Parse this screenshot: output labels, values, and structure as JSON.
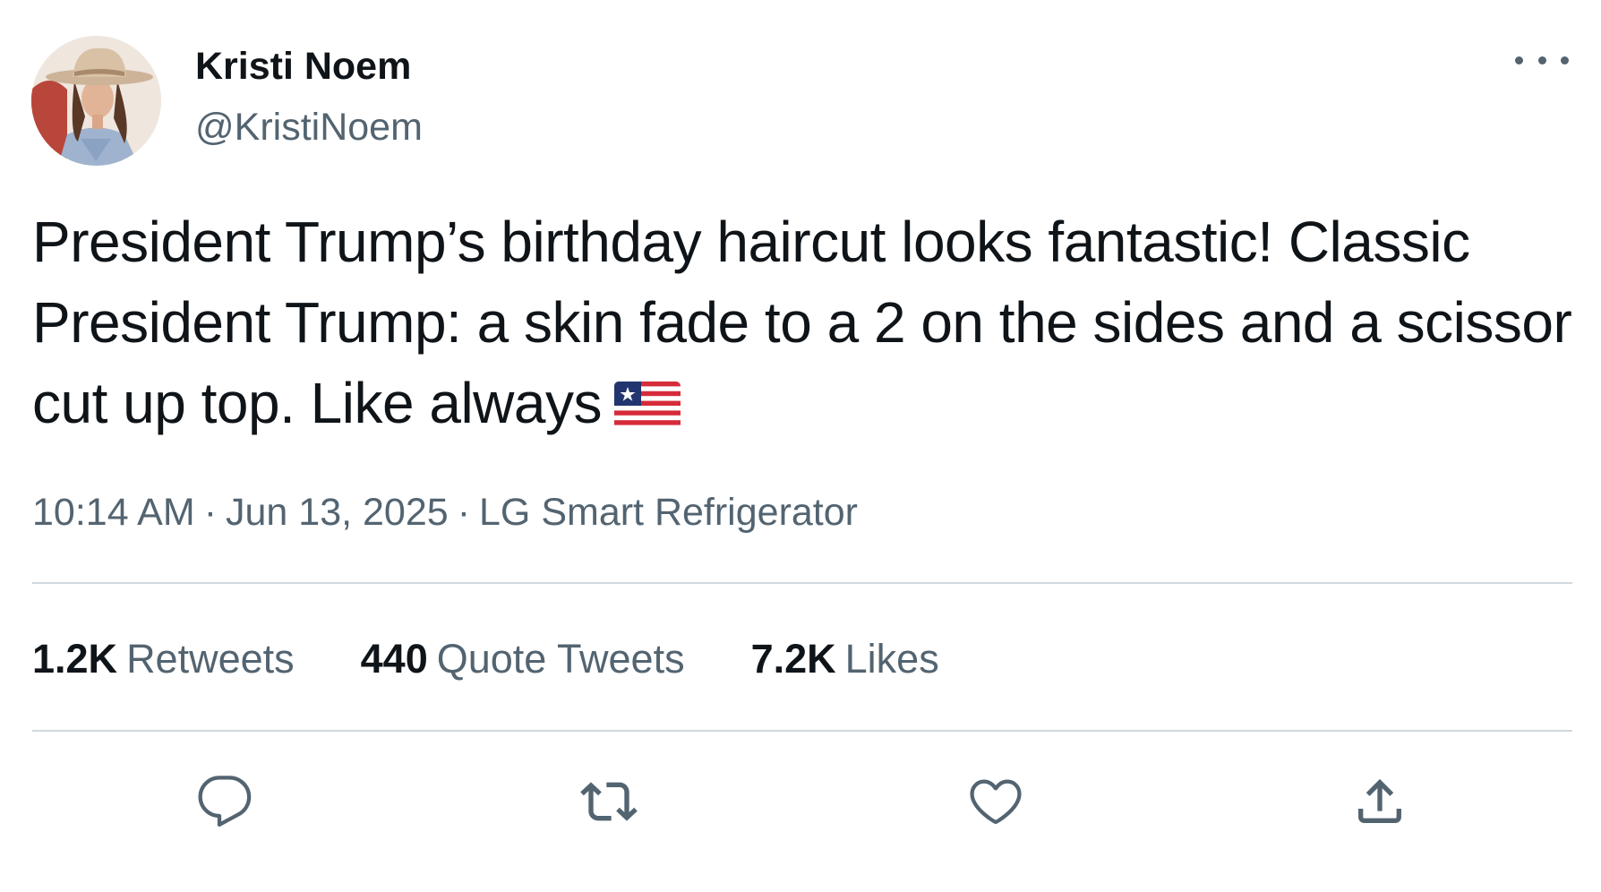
{
  "author": {
    "display_name": "Kristi Noem",
    "handle": "@KristiNoem",
    "avatar": "profile-photo-woman-cowboy-hat"
  },
  "tweet": {
    "text": "President Trump’s birthday haircut looks fantastic! Classic President Trump: a skin fade to a 2 on the sides and a scissor cut up top. Like always",
    "emoji": "us-flag-emoji"
  },
  "meta": {
    "time": "10:14 AM",
    "separator": "·",
    "date": "Jun 13, 2025",
    "source": "LG Smart Refrigerator"
  },
  "stats": {
    "retweets_count": "1.2K",
    "retweets_label": "Retweets",
    "quotes_count": "440",
    "quotes_label": "Quote Tweets",
    "likes_count": "7.2K",
    "likes_label": "Likes"
  },
  "actions": {
    "reply_icon": "reply-icon",
    "retweet_icon": "retweet-icon",
    "like_icon": "heart-icon",
    "share_icon": "share-icon"
  },
  "colors": {
    "text_primary": "#0f1419",
    "text_secondary": "#536471",
    "divider": "#cfd9de",
    "background": "#ffffff"
  }
}
